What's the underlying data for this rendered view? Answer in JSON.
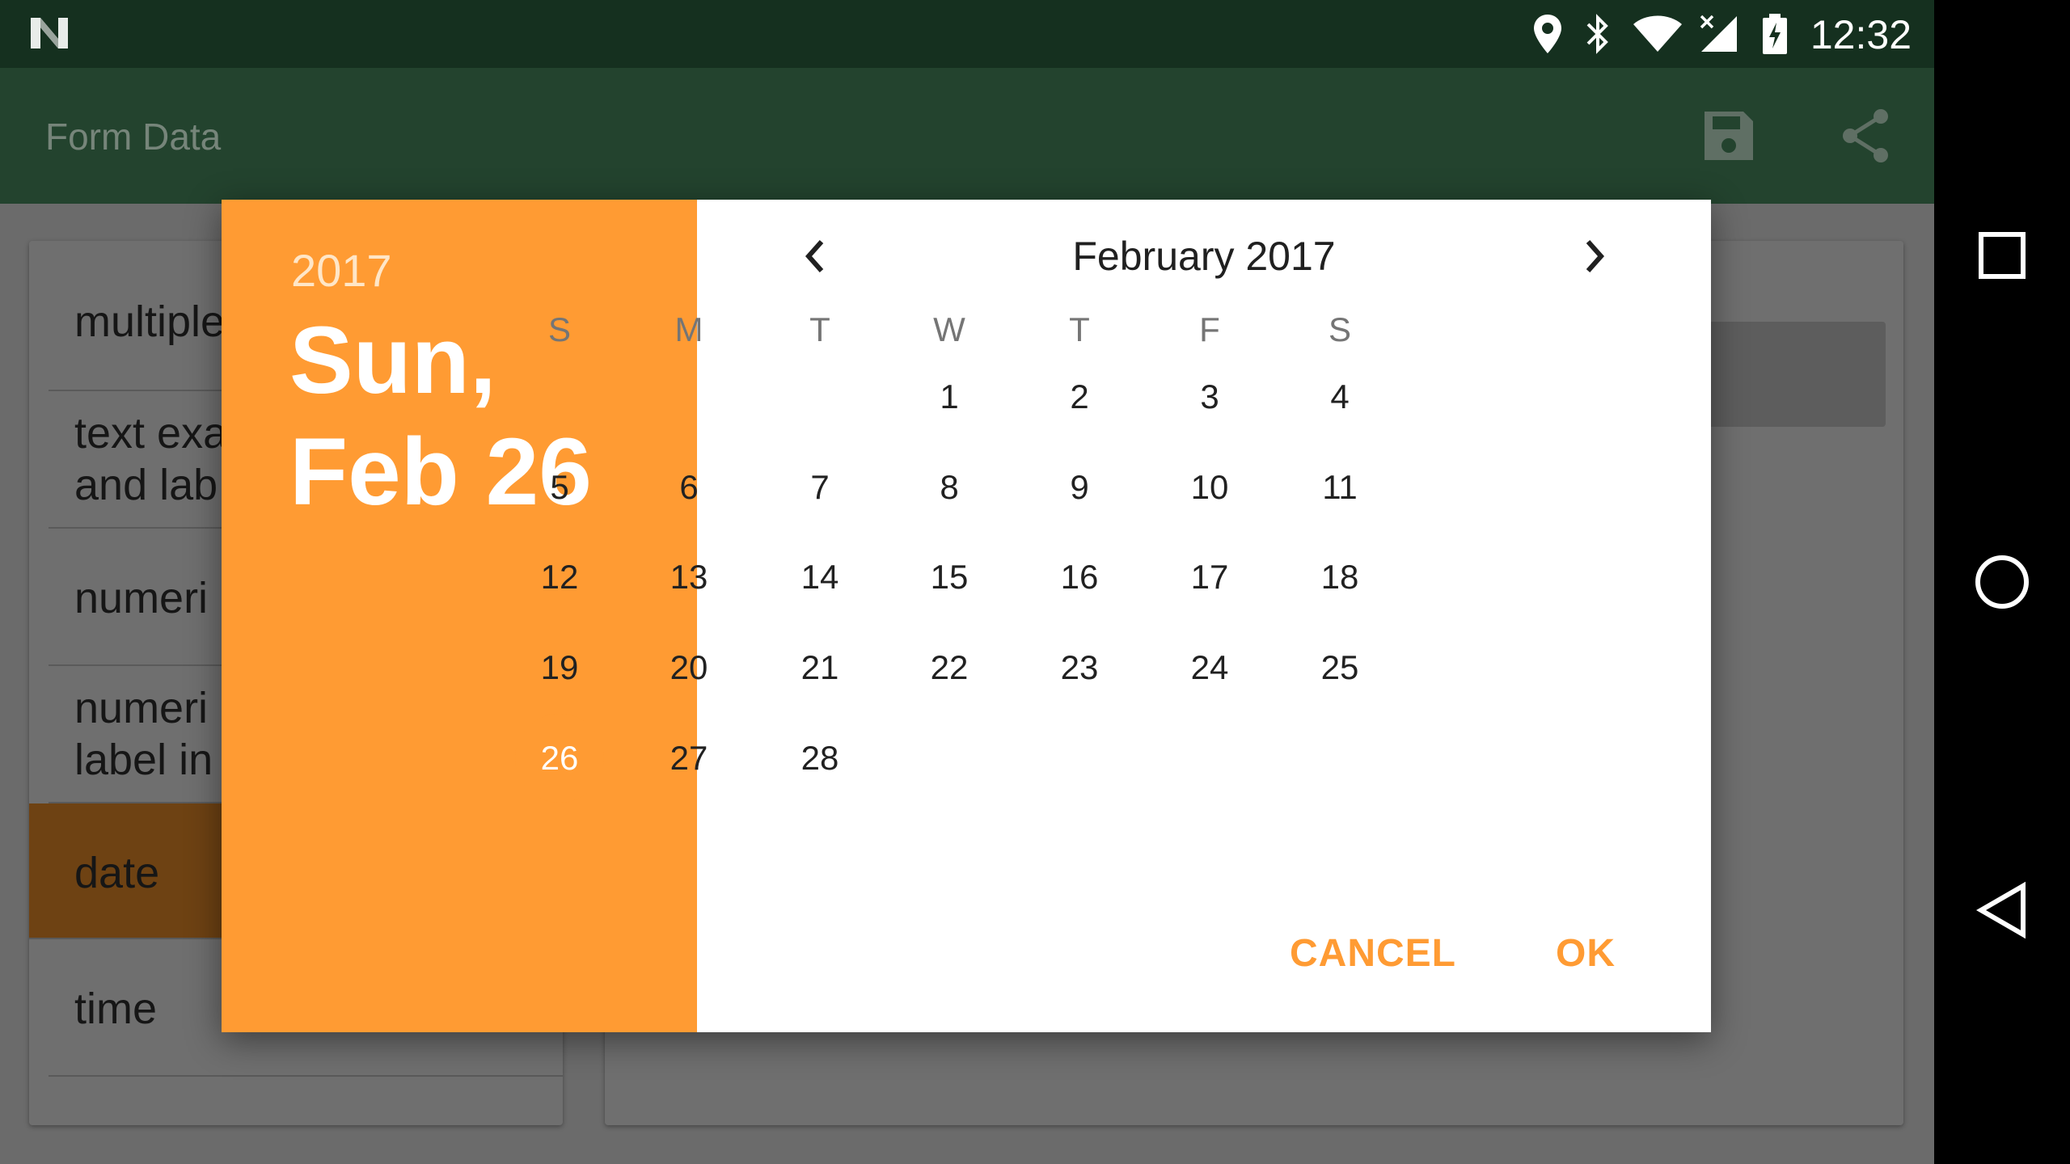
{
  "status_bar": {
    "time": "12:32",
    "icons": [
      "n-logo-icon",
      "location-icon",
      "bluetooth-icon",
      "wifi-icon",
      "signal-icon",
      "battery-charging-icon"
    ]
  },
  "app_bar": {
    "title": "Form Data",
    "actions": [
      "save-icon",
      "share-icon"
    ]
  },
  "background_list": {
    "items": [
      {
        "label": "multiple"
      },
      {
        "label": "text exa\nand lab"
      },
      {
        "label": "numeri"
      },
      {
        "label": "numeri\nlabel in"
      },
      {
        "label": "date",
        "selected": true
      },
      {
        "label": "time"
      }
    ]
  },
  "date_picker": {
    "header_year": "2017",
    "header_date": "Sun, Feb 26",
    "month_title": "February 2017",
    "weekdays": [
      "S",
      "M",
      "T",
      "W",
      "T",
      "F",
      "S"
    ],
    "weeks": [
      [
        "",
        "",
        "",
        "1",
        "2",
        "3",
        "4"
      ],
      [
        "5",
        "6",
        "7",
        "8",
        "9",
        "10",
        "11"
      ],
      [
        "12",
        "13",
        "14",
        "15",
        "16",
        "17",
        "18"
      ],
      [
        "19",
        "20",
        "21",
        "22",
        "23",
        "24",
        "25"
      ],
      [
        "26",
        "27",
        "28",
        "",
        "",
        "",
        ""
      ]
    ],
    "selected_day": "26",
    "cancel_label": "CANCEL",
    "ok_label": "OK",
    "accent_color": "#ff9b33"
  },
  "nav_bar": {
    "buttons": [
      "recents-icon",
      "home-icon",
      "back-icon"
    ]
  }
}
